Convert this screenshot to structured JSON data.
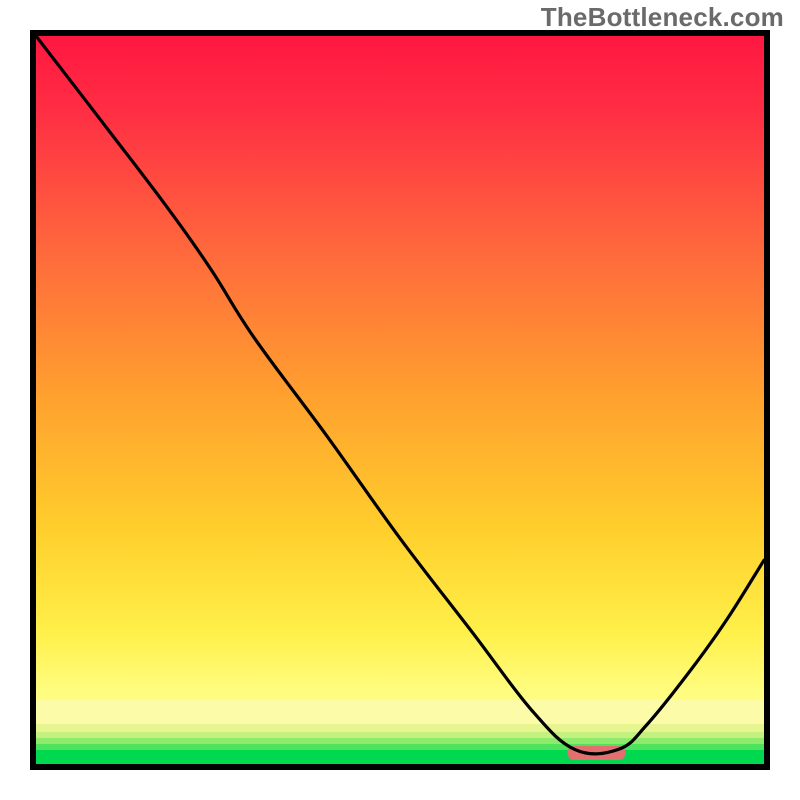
{
  "watermark": "TheBottleneck.com",
  "chart_data": {
    "type": "line",
    "x": [
      0.0,
      0.1,
      0.18,
      0.24,
      0.3,
      0.4,
      0.5,
      0.6,
      0.68,
      0.74,
      0.8,
      0.84,
      0.9,
      0.95,
      1.0
    ],
    "values": [
      1.0,
      0.87,
      0.765,
      0.68,
      0.585,
      0.45,
      0.31,
      0.18,
      0.075,
      0.02,
      0.02,
      0.055,
      0.13,
      0.2,
      0.28
    ],
    "xlim": [
      0,
      1
    ],
    "ylim": [
      0,
      1
    ],
    "marker_region": {
      "x_start": 0.73,
      "x_end": 0.81,
      "color": "#e36f6f"
    },
    "bottom_band_colors": [
      "#00e25a",
      "#6cea5a",
      "#b6f070",
      "#e8f48a",
      "#fdf9a0"
    ],
    "gradient": {
      "top": "#ff1c44",
      "mid": "#ffb000",
      "bottom_yellow": "#fff95a",
      "green": "#00d94f"
    }
  }
}
